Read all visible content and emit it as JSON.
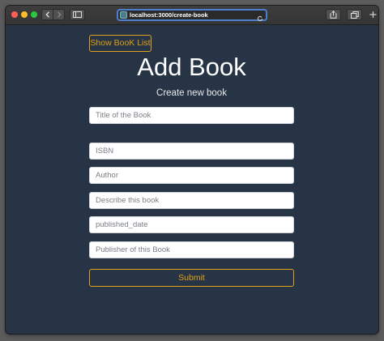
{
  "browser": {
    "url": "localhost:3000/create-book"
  },
  "page": {
    "show_list_label": "Show BooK List",
    "title": "Add Book",
    "subtitle": "Create new book",
    "fields": {
      "title": {
        "placeholder": "Title of the Book",
        "value": ""
      },
      "isbn": {
        "placeholder": "ISBN",
        "value": ""
      },
      "author": {
        "placeholder": "Author",
        "value": ""
      },
      "description": {
        "placeholder": "Describe this book",
        "value": ""
      },
      "published_date": {
        "placeholder": "published_date",
        "value": ""
      },
      "publisher": {
        "placeholder": "Publisher of this Book",
        "value": ""
      }
    },
    "submit_label": "Submit"
  },
  "colors": {
    "page_background": "#263445",
    "accent": "#e0a01a",
    "address_focus": "#4d7fcd"
  },
  "icons": [
    "back-icon",
    "forward-icon",
    "sidebar-icon",
    "site-icon",
    "reload-icon",
    "share-icon",
    "tabs-icon",
    "new-tab-icon"
  ]
}
